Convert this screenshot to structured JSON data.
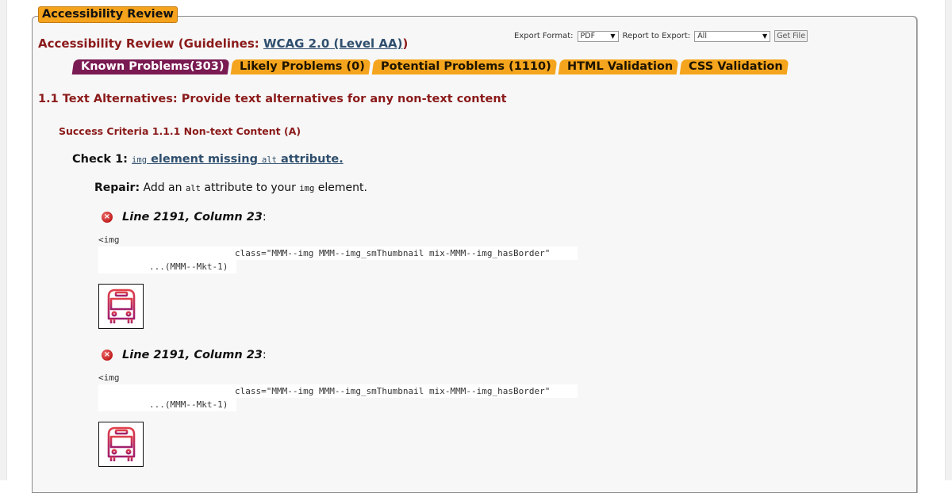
{
  "panel": {
    "legend": "Accessibility Review",
    "title_prefix": "Accessibility Review (Guidelines: ",
    "title_link": "WCAG 2.0 (Level AA)",
    "title_suffix": ")"
  },
  "export": {
    "format_label": "Export Format:",
    "format_value": "PDF",
    "report_label": "Report to Export:",
    "report_value": "All",
    "get_file_label": "Get File"
  },
  "tabs": [
    {
      "label": "Known Problems(303)",
      "active": true
    },
    {
      "label": "Likely Problems (0)",
      "active": false
    },
    {
      "label": "Potential Problems (1110)",
      "active": false
    },
    {
      "label": "HTML Validation",
      "active": false
    },
    {
      "label": "CSS Validation",
      "active": false
    }
  ],
  "section": {
    "heading": "1.1 Text Alternatives: Provide text alternatives for any non-text content",
    "criteria": "Success Criteria 1.1.1 Non-text Content (A)",
    "check_label": "Check 1:",
    "check_link_code1": "img",
    "check_link_text1": " element missing ",
    "check_link_code2": "alt",
    "check_link_text2": " attribute.",
    "repair_label": "Repair:",
    "repair_text1": " Add an ",
    "repair_code1": "alt",
    "repair_text2": " attribute to your ",
    "repair_code2": "img",
    "repair_text3": " element."
  },
  "issues": [
    {
      "location": "Line 2191, Column 23",
      "colon": ":",
      "code_line1": "<img",
      "code_line2": "class=\"MMM--img MMM--img_smThumbnail mix-MMM--img_hasBorder\"",
      "code_line3": "...(MMM--Mkt-1)",
      "thumbnail_icon": "bus-icon"
    },
    {
      "location": "Line 2191, Column 23",
      "colon": ":",
      "code_line1": "<img",
      "code_line2": "class=\"MMM--img MMM--img_smThumbnail mix-MMM--img_hasBorder\"",
      "code_line3": "...(MMM--Mkt-1)",
      "thumbnail_icon": "bus-icon"
    }
  ],
  "colors": {
    "tab_active": "#7a1a52",
    "tab_inactive": "#f5a51d",
    "heading_red": "#8b1a1a",
    "link_blue": "#2f4f6e",
    "error_red": "#c01e1e"
  }
}
